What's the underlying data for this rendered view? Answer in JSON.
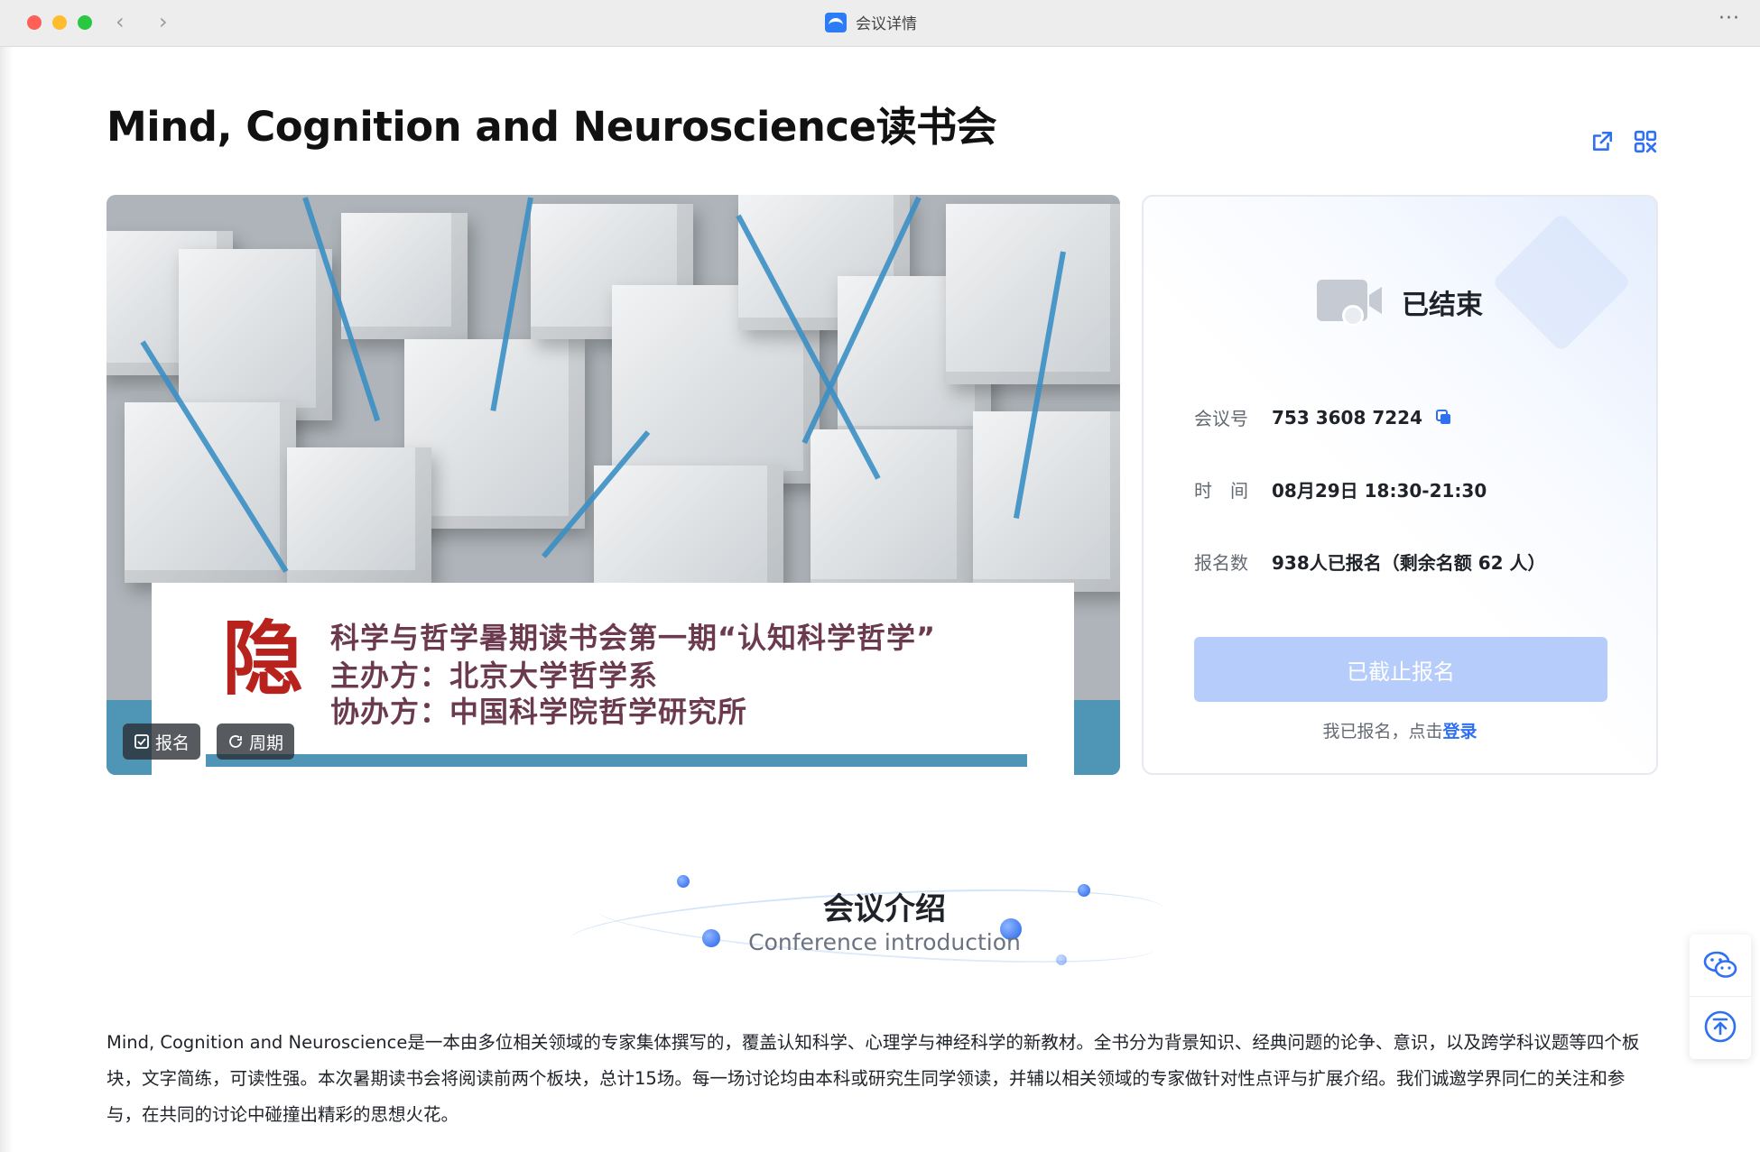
{
  "window": {
    "title": "会议详情",
    "back_icon": "chevron-left-icon",
    "forward_icon": "chevron-right-icon",
    "more_label": "···"
  },
  "meeting": {
    "title": "Mind, Cognition and Neuroscience读书会"
  },
  "banner": {
    "caption_line1": "科学与哲学暑期读书会第一期“认知科学哲学”",
    "caption_line2": "主办方：北京大学哲学系",
    "caption_line3": "协办方：中国科学院哲学研究所",
    "seal_text": "隐",
    "tags": [
      {
        "icon": "signup-icon",
        "label": "报名"
      },
      {
        "icon": "repeat-icon",
        "label": "周期"
      }
    ]
  },
  "info": {
    "status": "已结束",
    "meeting_id_label": "会议号",
    "meeting_id": "753 3608 7224",
    "time_label": "时　间",
    "time": "08月29日 18:30-21:30",
    "signup_label": "报名数",
    "signup_value": "938人已报名（剩余名额 62 人）",
    "signup_button": "已截止报名",
    "login_tip": "我已报名，点击",
    "login_link": "登录"
  },
  "intro": {
    "title": "会议介绍",
    "subtitle": "Conference introduction",
    "description": "Mind, Cognition and Neuroscience是一本由多位相关领域的专家集体撰写的，覆盖认知科学、心理学与神经科学的新教材。全书分为背景知识、经典问题的论争、意识，以及跨学科议题等四个板块，文字简练，可读性强。本次暑期读书会将阅读前两个板块，总计15场。每一场讨论均由本科或研究生同学领读，并辅以相关领域的专家做针对性点评与扩展介绍。我们诚邀学界同仁的关注和参与，在共同的讨论中碰撞出精彩的思想火花。"
  },
  "colors": {
    "accent": "#2f6ff2",
    "disabled_button": "#b6cdfb",
    "caption_text": "#6b3a4e",
    "seal": "#b7221d"
  }
}
